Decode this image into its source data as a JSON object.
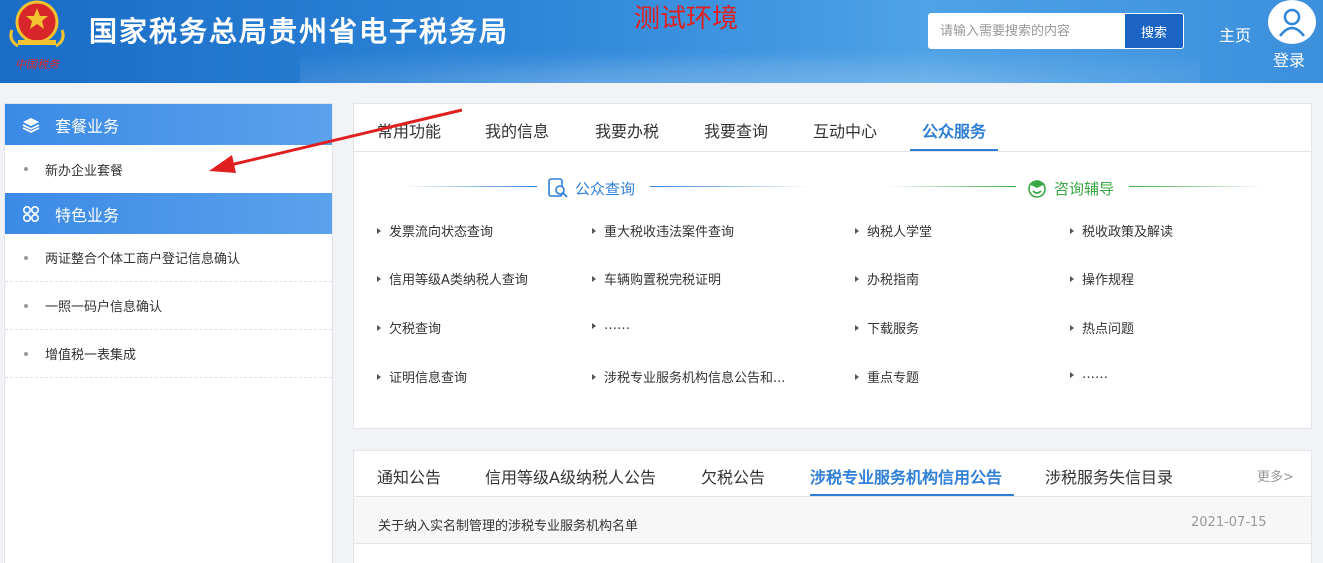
{
  "header": {
    "title": "国家税务总局贵州省电子税务局",
    "env_label": "测试环境",
    "emblem_caption": "中国税务",
    "search_placeholder": "请输入需要搜索的内容",
    "search_button": "搜索",
    "home": "主页",
    "login": "登录"
  },
  "sidebar": {
    "sections": [
      {
        "title": "套餐业务",
        "icon": "layers-icon",
        "items": [
          "新办企业套餐"
        ]
      },
      {
        "title": "特色业务",
        "icon": "apps-icon",
        "items": [
          "两证整合个体工商户登记信息确认",
          "一照一码户信息确认",
          "增值税一表集成"
        ]
      }
    ]
  },
  "main": {
    "tabs": [
      "常用功能",
      "我的信息",
      "我要办税",
      "我要查询",
      "互动中心",
      "公众服务"
    ],
    "active_tab": "公众服务",
    "public_query": {
      "title": "公众查询",
      "col1": [
        "发票流向状态查询",
        "信用等级A类纳税人查询",
        "欠税查询",
        "证明信息查询"
      ],
      "col2": [
        "重大税收违法案件查询",
        "车辆购置税完税证明",
        "……",
        "涉税专业服务机构信息公告和..."
      ]
    },
    "consult": {
      "title": "咨询辅导",
      "col1": [
        "纳税人学堂",
        "办税指南",
        "下载服务",
        "重点专题"
      ],
      "col2": [
        "税收政策及解读",
        "操作规程",
        "热点问题",
        "……"
      ]
    }
  },
  "notice": {
    "tabs": [
      "通知公告",
      "信用等级A级纳税人公告",
      "欠税公告",
      "涉税专业服务机构信用公告",
      "涉税服务失信目录"
    ],
    "active_tab": "涉税专业服务机构信用公告",
    "more": "更多>",
    "rows": [
      {
        "title": "关于纳入实名制管理的涉税专业服务机构名单",
        "date": "2021-07-15"
      }
    ]
  },
  "colors": {
    "accent": "#2f7fd6",
    "header": "#2e86d9",
    "env": "#e02020",
    "consult_green": "#3aa845"
  }
}
